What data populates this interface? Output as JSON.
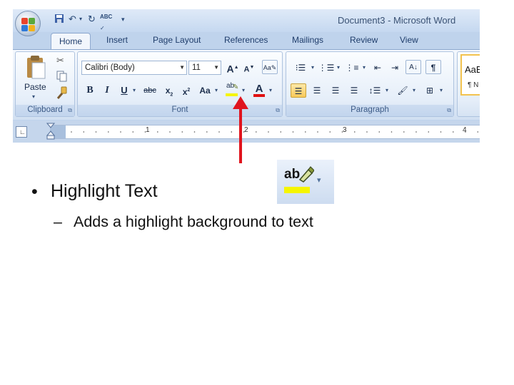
{
  "window": {
    "title": "Document3 - Microsoft Word",
    "quick_access_abc": "ABC"
  },
  "tabs": [
    "Home",
    "Insert",
    "Page Layout",
    "References",
    "Mailings",
    "Review",
    "View"
  ],
  "ribbon": {
    "clipboard": {
      "label": "Clipboard",
      "paste_label": "Paste"
    },
    "font": {
      "label": "Font",
      "font_name": "Calibri (Body)",
      "font_size": "11",
      "highlight_glyph": "ab",
      "highlight_color": "#f5f500",
      "font_color": "#e01010"
    },
    "paragraph": {
      "label": "Paragraph"
    },
    "styles": {
      "preview_1": "AaB",
      "preview_2": "¶ N"
    }
  },
  "ruler": {
    "numbers": [
      "1",
      "2",
      "3",
      "4"
    ]
  },
  "annotation": {
    "arrow_color": "#e0141e"
  },
  "zoomed_icon": {
    "glyph": "ab",
    "highlight_color": "#f5f500"
  },
  "slide": {
    "bullet_marker": "•",
    "bullet_text": "Highlight Text",
    "sub_marker": "–",
    "sub_text": "Adds a highlight background to text"
  }
}
